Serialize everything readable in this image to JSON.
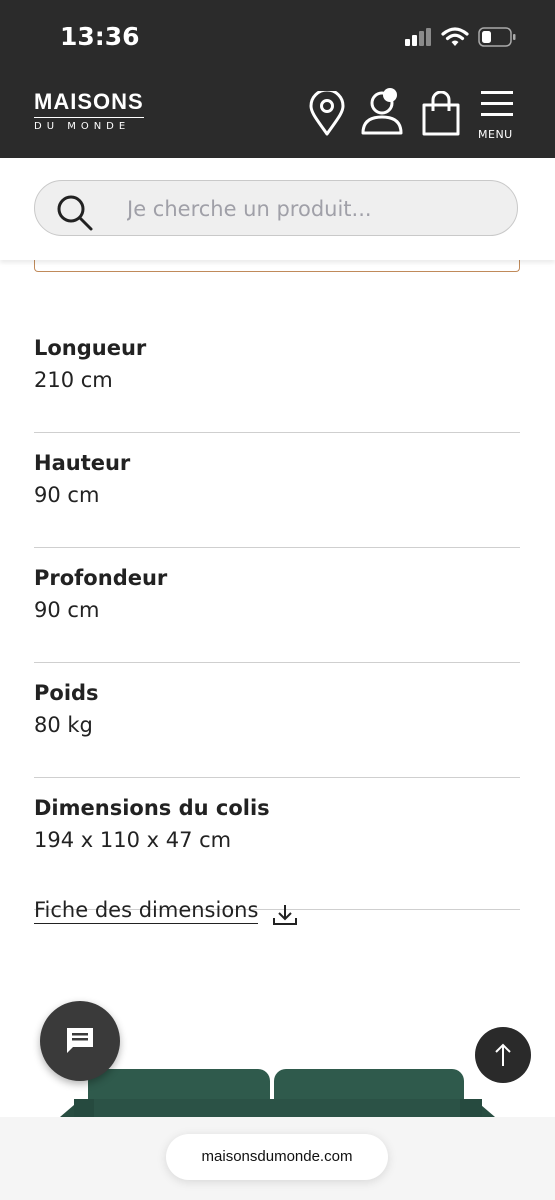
{
  "status_bar": {
    "time": "13:36"
  },
  "header": {
    "logo_top": "MAISONS",
    "logo_bottom": "DU MONDE",
    "menu_label": "MENU"
  },
  "search": {
    "placeholder": "Je cherche un produit..."
  },
  "specs": [
    {
      "label": "Longueur",
      "value": "210 cm"
    },
    {
      "label": "Hauteur",
      "value": "90 cm"
    },
    {
      "label": "Profondeur",
      "value": "90 cm"
    },
    {
      "label": "Poids",
      "value": "80 kg"
    },
    {
      "label": "Dimensions du colis",
      "value": "194 x 110 x 47 cm"
    }
  ],
  "fiche_link": "Fiche des dimensions",
  "browser": {
    "url": "maisonsdumonde.com"
  },
  "colors": {
    "header_bg": "#2b2b2b",
    "sofa": "#2f5a4c",
    "accent_border": "#c08a5a"
  },
  "icons": [
    "signal-icon",
    "wifi-icon",
    "battery-icon",
    "location-icon",
    "account-icon",
    "shopping-bag-icon",
    "menu-icon",
    "search-icon",
    "download-icon",
    "chat-icon",
    "arrow-up-icon"
  ]
}
